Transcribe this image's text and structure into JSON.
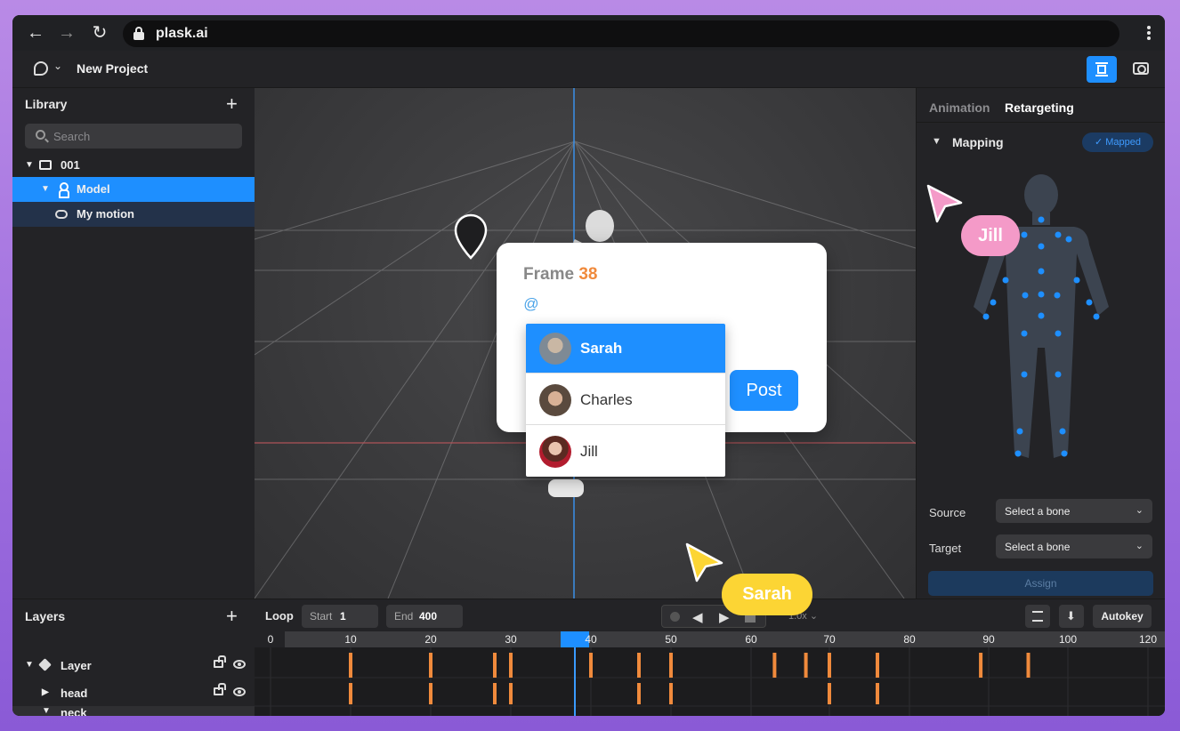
{
  "browser": {
    "url": "plask.ai"
  },
  "app": {
    "project_title": "New Project"
  },
  "library": {
    "title": "Library",
    "search_placeholder": "Search",
    "tree": [
      {
        "label": "001"
      },
      {
        "label": "Model"
      },
      {
        "label": "My motion"
      }
    ]
  },
  "right_panel": {
    "tabs": [
      {
        "label": "Animation"
      },
      {
        "label": "Retargeting"
      }
    ],
    "section_title": "Mapping",
    "mapped_badge": "Mapped",
    "source_label": "Source",
    "target_label": "Target",
    "source_value": "Select a bone",
    "target_value": "Select a bone",
    "assign_label": "Assign"
  },
  "layers": {
    "title": "Layers",
    "rows": [
      {
        "label": "Layer"
      },
      {
        "label": "head"
      },
      {
        "label": "neck"
      }
    ]
  },
  "timeline": {
    "loop_label": "Loop",
    "start_label": "Start",
    "start_value": "1",
    "end_label": "End",
    "end_value": "400",
    "speed_value": "1.0x",
    "autokey_label": "Autokey",
    "ruler": [
      "0",
      "10",
      "20",
      "30",
      "40",
      "50",
      "60",
      "70",
      "80",
      "90",
      "100",
      "120"
    ],
    "current_frame": 38,
    "keyframes_row1": [
      10,
      20,
      28,
      30,
      40,
      46,
      50,
      63,
      67,
      70,
      76,
      89,
      95
    ],
    "keyframes_row2": [
      10,
      20,
      28,
      30,
      46,
      50,
      70,
      76
    ]
  },
  "comment": {
    "frame_label": "Frame",
    "frame_number": "38",
    "mention_trigger": "@",
    "post_label": "Post",
    "mentions": [
      {
        "name": "Sarah"
      },
      {
        "name": "Charles"
      },
      {
        "name": "Jill"
      }
    ]
  },
  "cursors": {
    "jill": {
      "name": "Jill",
      "color": "#f49ac8"
    },
    "sarah": {
      "name": "Sarah",
      "color": "#fcd534"
    }
  },
  "colors": {
    "accent": "#1e8fff",
    "keyframe": "#f08a3c",
    "playhead": "#3a9bff"
  }
}
